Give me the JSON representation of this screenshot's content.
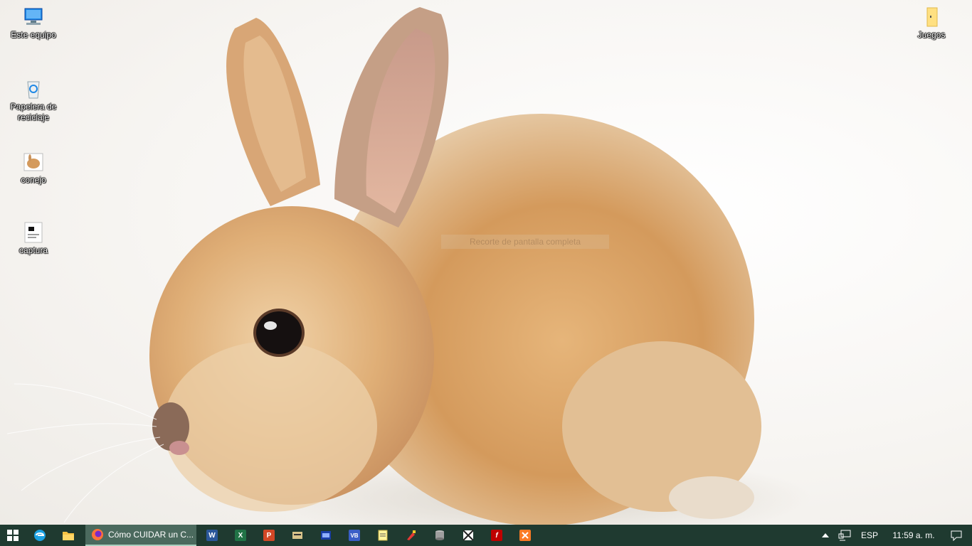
{
  "desktop": {
    "icons": [
      {
        "label": "Este equipo",
        "icon": "computer-icon"
      },
      {
        "label": "Papelera de reciclaje",
        "icon": "recycle-bin-icon"
      },
      {
        "label": "conejo",
        "icon": "image-file-icon"
      },
      {
        "label": "captura",
        "icon": "screenshot-file-icon"
      },
      {
        "label": "Juegos",
        "icon": "folder-icon"
      }
    ],
    "overlay_text": "Recorte de pantalla completa"
  },
  "taskbar": {
    "active_window_title": "Cómo CUIDAR un C...",
    "pinned": [
      {
        "name": "edge-legacy-icon"
      },
      {
        "name": "file-explorer-icon"
      },
      {
        "name": "word-icon",
        "letter": "W",
        "color": "#2b579a"
      },
      {
        "name": "excel-icon",
        "letter": "X",
        "color": "#217346"
      },
      {
        "name": "powerpoint-icon",
        "letter": "P",
        "color": "#d24726"
      },
      {
        "name": "app-icon-1"
      },
      {
        "name": "app-icon-2"
      },
      {
        "name": "visual-basic-icon",
        "letter": "VB",
        "color": "#3a5ec7"
      },
      {
        "name": "notepad-icon"
      },
      {
        "name": "paint-icon"
      },
      {
        "name": "database-icon"
      },
      {
        "name": "app-icon-3"
      },
      {
        "name": "filezilla-icon",
        "letter": "f",
        "color": "#bf0000"
      },
      {
        "name": "xampp-icon",
        "color": "#fb7a24"
      }
    ],
    "tray": {
      "language": "ESP",
      "time": "11:59 a. m."
    }
  }
}
